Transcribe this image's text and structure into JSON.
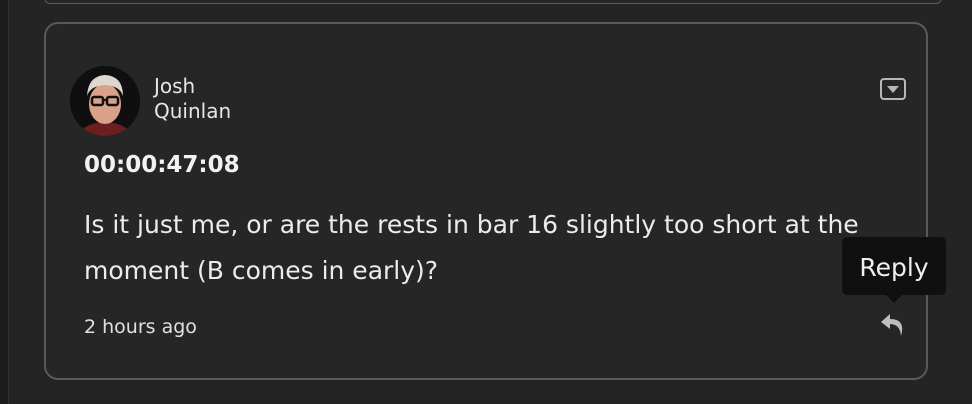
{
  "comment": {
    "author_first": "Josh",
    "author_last": "Quinlan",
    "timecode": "00:00:47:08",
    "text": "Is it just me, or are the rests in bar 16 slightly too short at the moment (B comes in early)?",
    "time_ago": "2 hours ago"
  },
  "actions": {
    "reply_tooltip": "Reply"
  },
  "icons": {
    "menu": "dropdown-menu-icon",
    "reply": "reply-arrow-icon"
  },
  "colors": {
    "background": "#242424",
    "card_border": "#5a5a5a",
    "text": "#ececec",
    "tooltip_bg": "#101010"
  }
}
